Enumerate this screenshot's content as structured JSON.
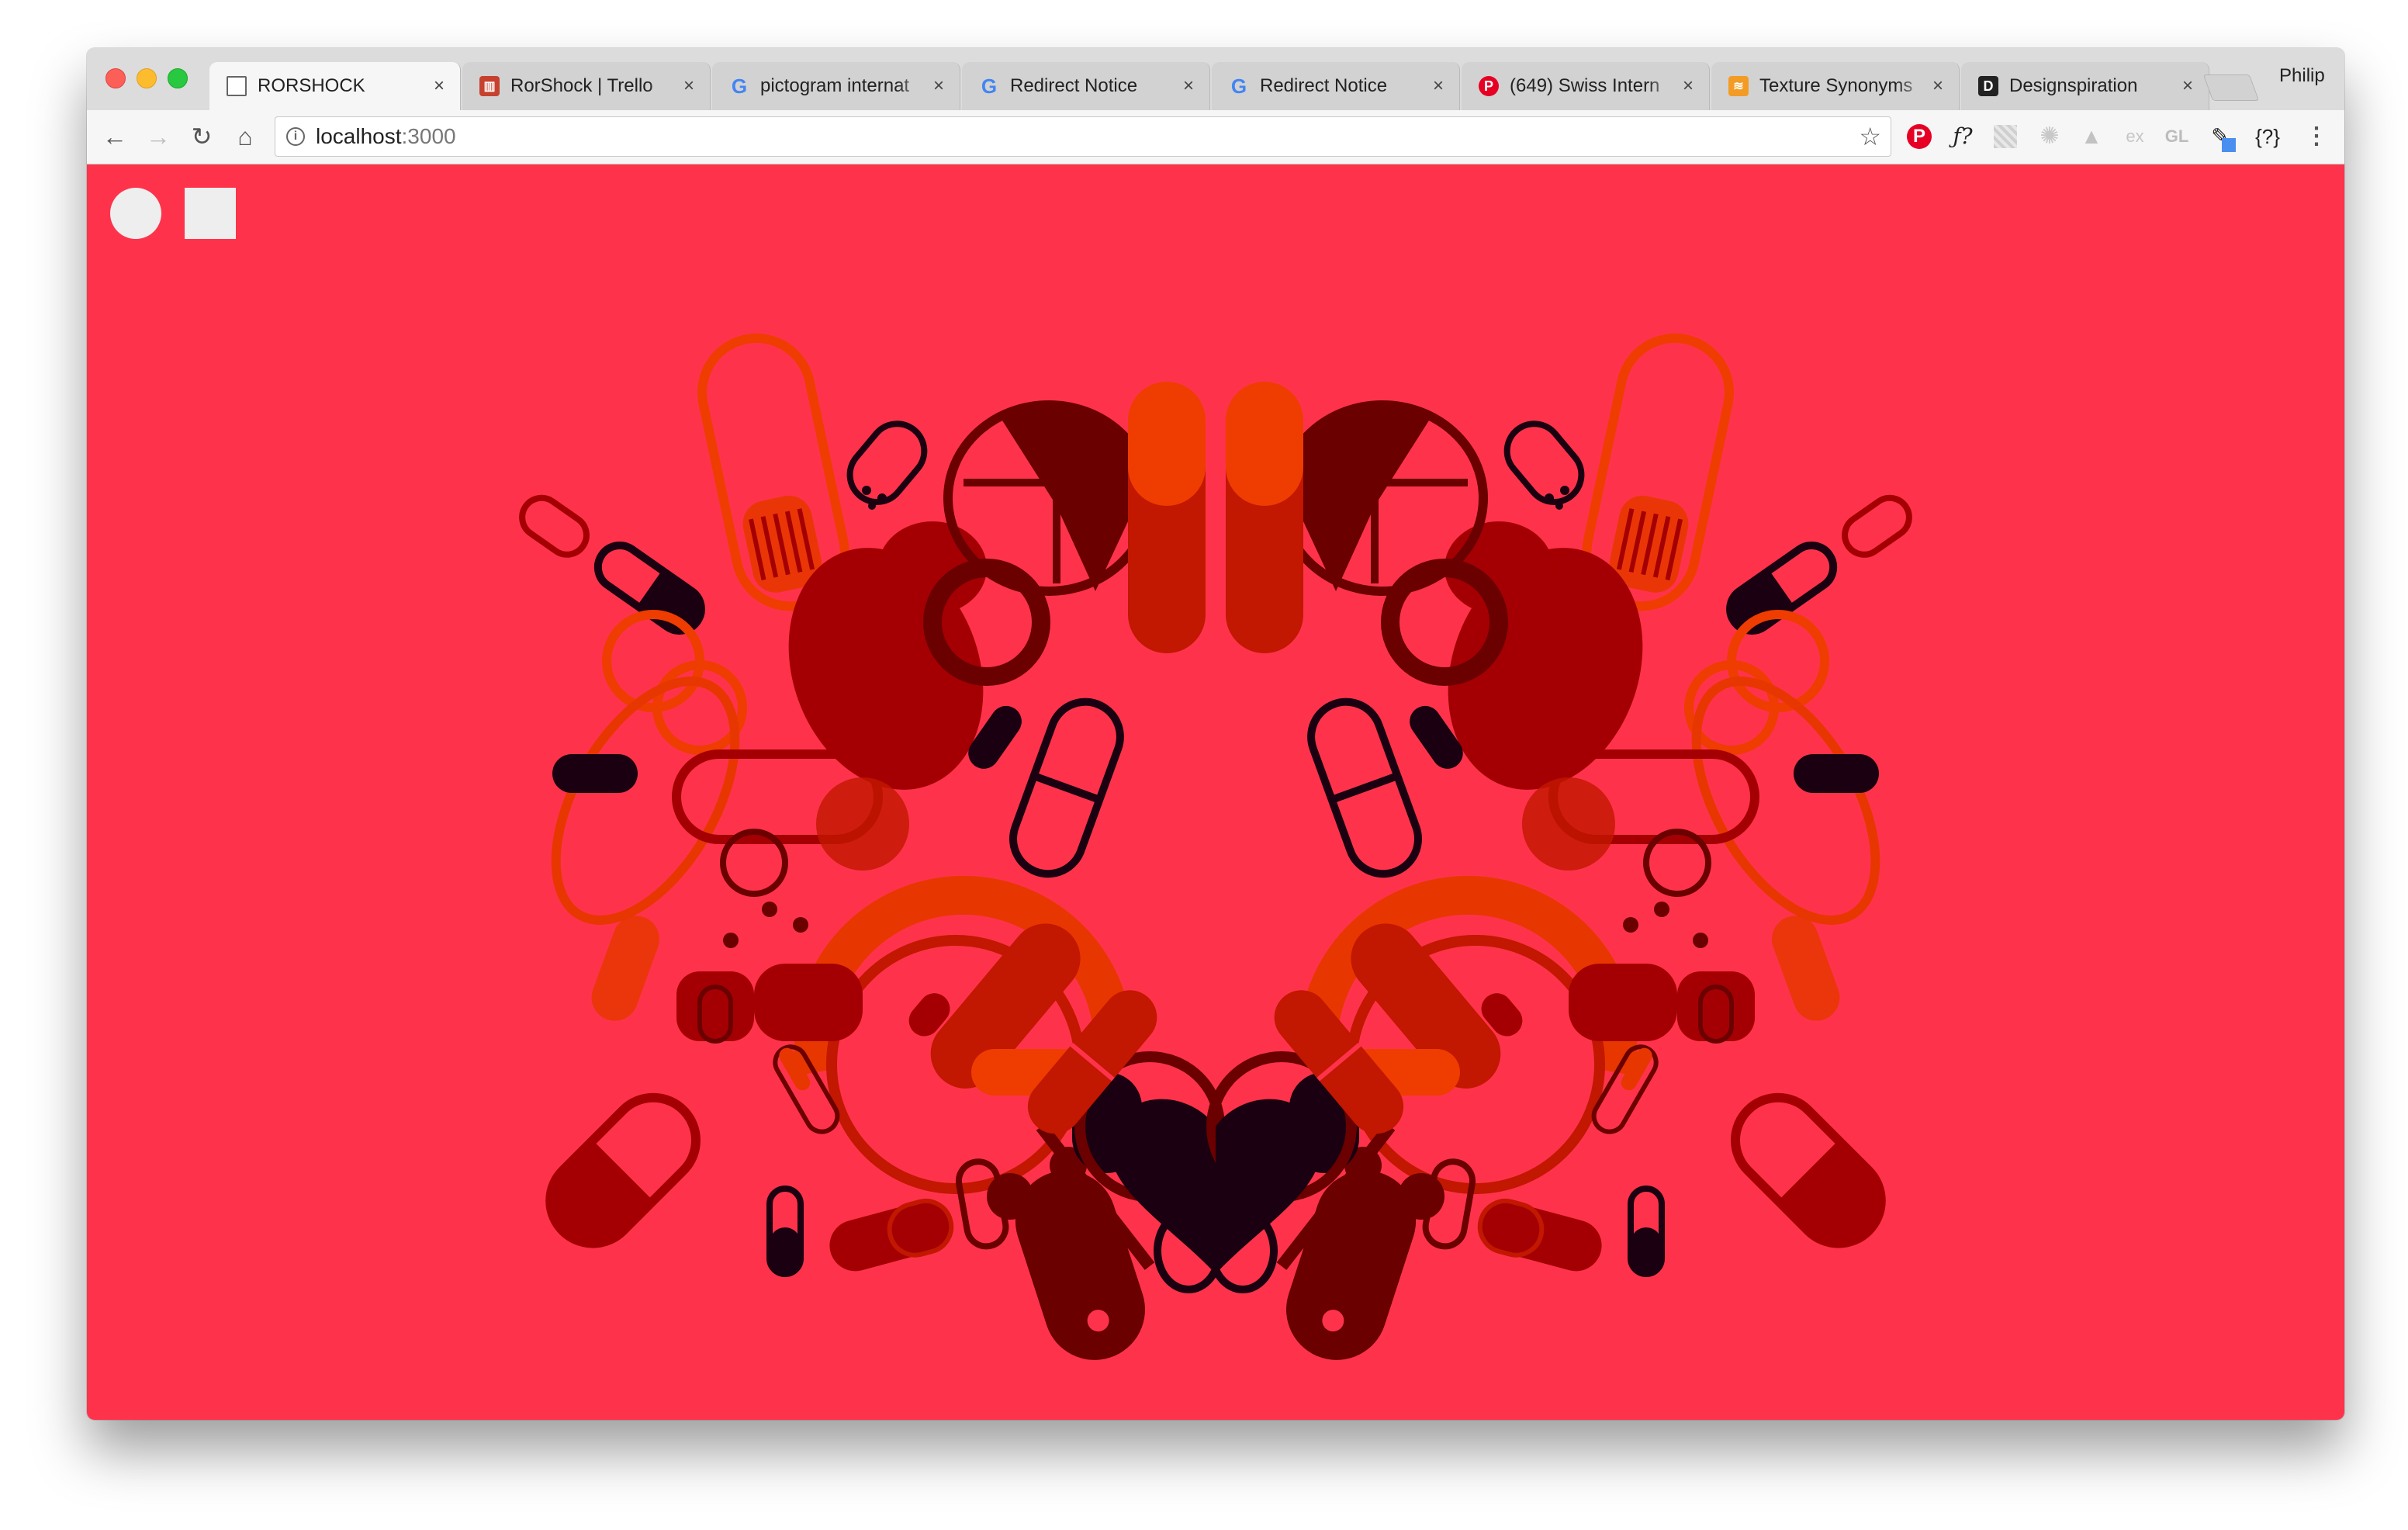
{
  "browser": {
    "tabs": [
      {
        "title": "RORSHOCK",
        "icon": "page-icon",
        "active": true
      },
      {
        "title": "RorShock | Trello",
        "icon": "trello-icon"
      },
      {
        "title": "pictogram internat",
        "icon": "google-icon"
      },
      {
        "title": "Redirect Notice",
        "icon": "google-icon"
      },
      {
        "title": "Redirect Notice",
        "icon": "google-icon"
      },
      {
        "title": "(649) Swiss Intern",
        "icon": "pinterest-icon"
      },
      {
        "title": "Texture Synonyms",
        "icon": "texture-icon"
      },
      {
        "title": "Designspiration",
        "icon": "designspiration-icon"
      }
    ],
    "profile_name": "Philip",
    "address": {
      "host": "localhost",
      "port": ":3000"
    },
    "extensions": {
      "font_ext": "ƒ?",
      "ex_ext": "ex",
      "gl_ext": "GL",
      "json_ext": "{?}"
    }
  },
  "page": {
    "background_color": "#fe334b",
    "controls": [
      {
        "shape": "circle",
        "color": "#eeeeee"
      },
      {
        "shape": "square",
        "color": "#eeeeee"
      }
    ],
    "palette": [
      "#a40003",
      "#6a0000",
      "#c21700",
      "#e83600",
      "#ef3c00",
      "#1a0010"
    ]
  }
}
